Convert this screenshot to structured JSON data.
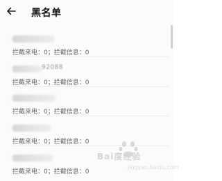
{
  "header": {
    "back_icon": "arrow-left-icon",
    "title": "黑名单"
  },
  "blacklist": {
    "items": [
      {
        "number_tail": "",
        "info": "拦截来电：0；拦截信息：0"
      },
      {
        "number_tail": "92088",
        "info": "拦截来电：0；拦截信息：0"
      },
      {
        "number_tail": "",
        "info": "拦截来电：0；拦截信息：0"
      },
      {
        "number_tail": "",
        "info": "拦截来电：0；拦截信息：0"
      },
      {
        "number_tail": "",
        "info": "拦截来电：0；拦截信息：0"
      }
    ]
  },
  "watermark": {
    "brand": "Bai度经验",
    "sub": "jingyan.baidu.com"
  },
  "colors": {
    "background": "#fbfbfb",
    "title": "#111111",
    "info_text": "#666666",
    "divider": "#ececec"
  }
}
